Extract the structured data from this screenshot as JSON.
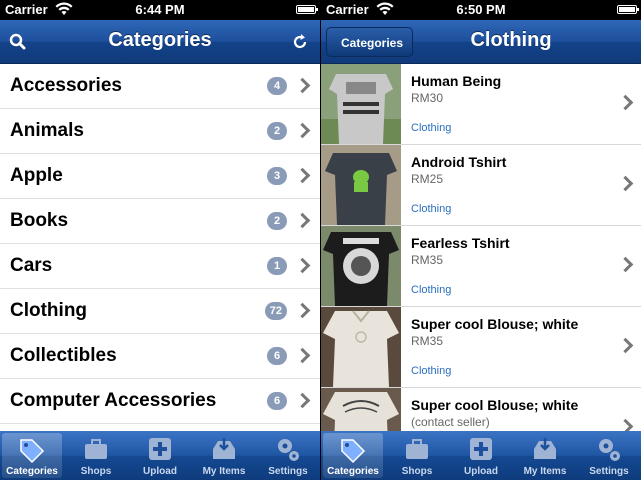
{
  "left_screen": {
    "status": {
      "carrier": "Carrier",
      "time": "6:44 PM"
    },
    "navbar": {
      "title": "Categories",
      "left_icon": "search-icon",
      "right_icon": "refresh-icon"
    },
    "categories": [
      {
        "label": "Accessories",
        "count": "4"
      },
      {
        "label": "Animals",
        "count": "2"
      },
      {
        "label": "Apple",
        "count": "3"
      },
      {
        "label": "Books",
        "count": "2"
      },
      {
        "label": "Cars",
        "count": "1"
      },
      {
        "label": "Clothing",
        "count": "72"
      },
      {
        "label": "Collectibles",
        "count": "6"
      },
      {
        "label": "Computer Accessories",
        "count": "6"
      }
    ]
  },
  "right_screen": {
    "status": {
      "carrier": "Carrier",
      "time": "6:50 PM"
    },
    "navbar": {
      "title": "Clothing",
      "back_label": "Categories"
    },
    "products": [
      {
        "name": "Human Being",
        "price": "RM30",
        "category": "Clothing"
      },
      {
        "name": "Android Tshirt",
        "price": "RM25",
        "category": "Clothing"
      },
      {
        "name": "Fearless Tshirt",
        "price": "RM35",
        "category": "Clothing"
      },
      {
        "name": "Super cool Blouse; white",
        "price": "RM35",
        "category": "Clothing"
      },
      {
        "name": "Super cool Blouse; white",
        "price": "(contact seller)",
        "category": ""
      }
    ]
  },
  "tabbar": {
    "active": "Categories",
    "tabs": [
      {
        "label": "Categories",
        "icon": "tag-icon"
      },
      {
        "label": "Shops",
        "icon": "briefcase-icon"
      },
      {
        "label": "Upload",
        "icon": "plus-box-icon"
      },
      {
        "label": "My Items",
        "icon": "inbox-icon"
      },
      {
        "label": "Settings",
        "icon": "gears-icon"
      }
    ]
  },
  "colors": {
    "nav_blue": "#1d4f9c",
    "badge": "#8a9bb7",
    "link_blue": "#2a6fc0"
  }
}
